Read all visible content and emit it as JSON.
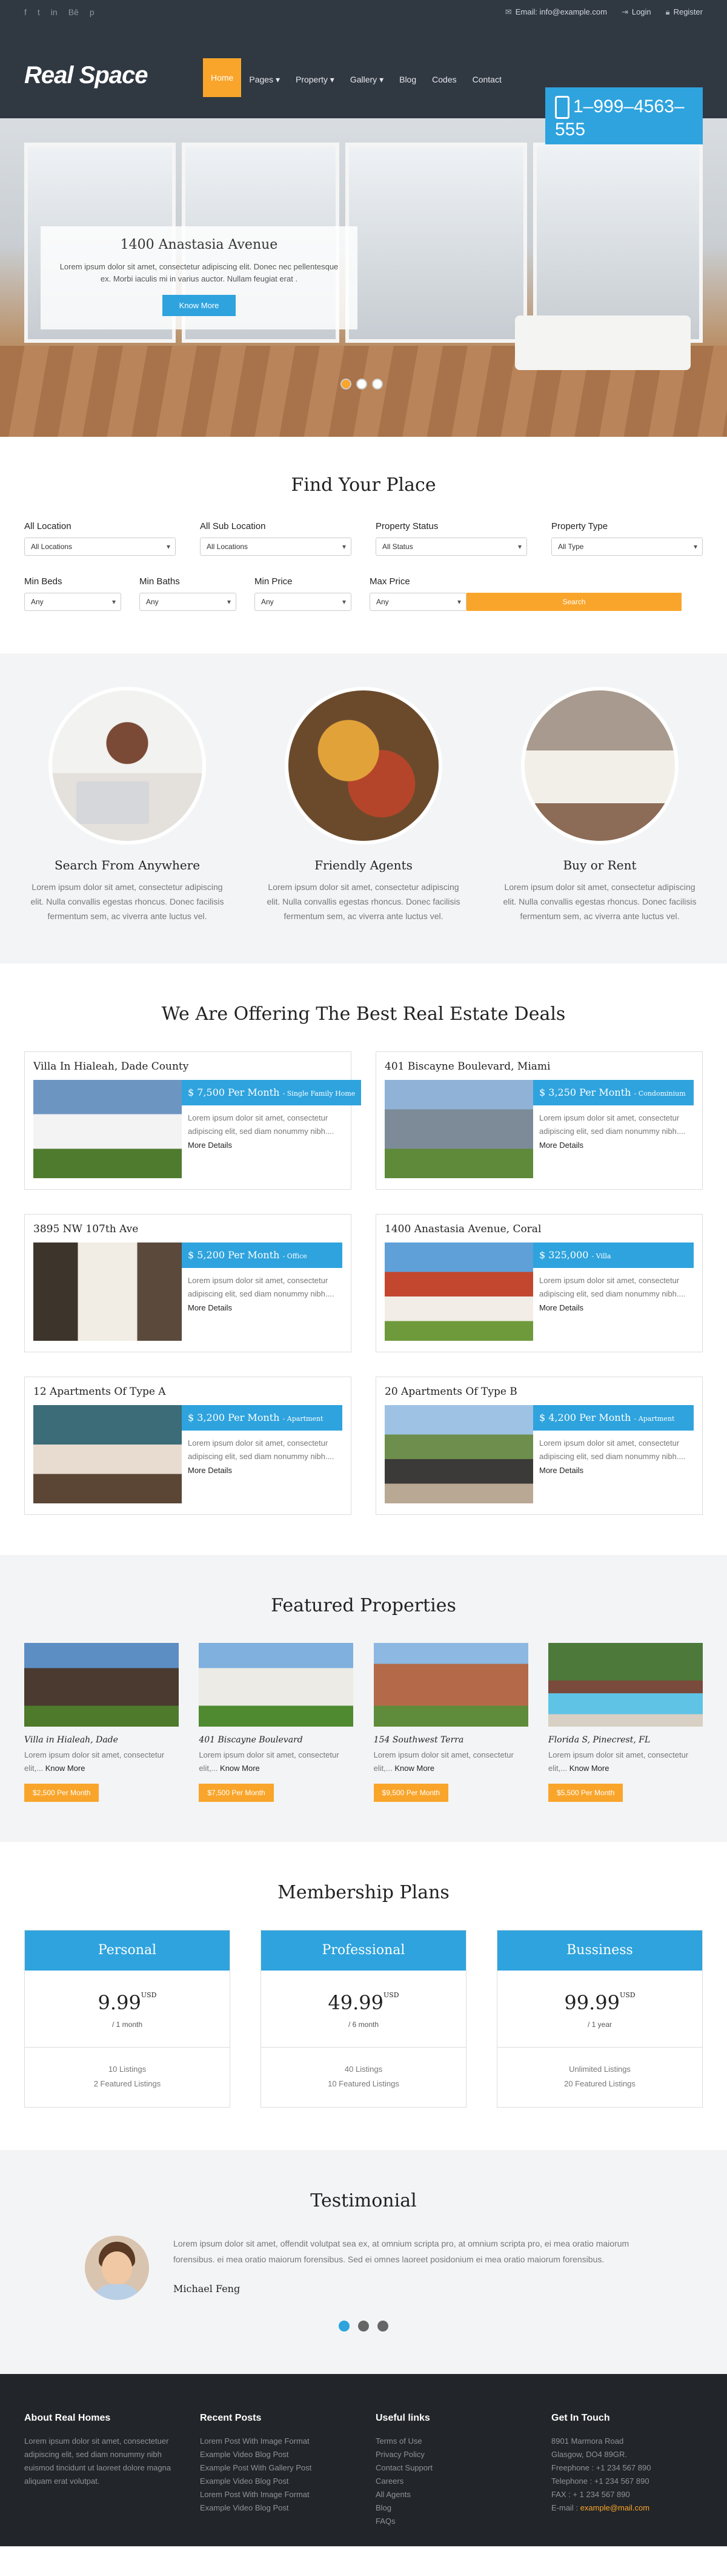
{
  "topbar": {
    "socials": [
      "f",
      "t",
      "in",
      "Bē",
      "p"
    ],
    "email": "Email: info@example.com",
    "login": "Login",
    "register": "Register"
  },
  "header": {
    "logo": "Real Space",
    "nav": [
      "Home",
      "Pages",
      "Property",
      "Gallery",
      "Blog",
      "Codes",
      "Contact"
    ],
    "phone": "1–999–4563–555"
  },
  "hero": {
    "title": "1400 Anastasia Avenue",
    "text": "Lorem ipsum dolor sit amet, consectetur adipiscing elit. Donec nec pellentesque ex. Morbi iaculis mi in varius auctor. Nullam feugiat erat .",
    "button": "Know More"
  },
  "find": {
    "title": "Find Your Place",
    "fields1": [
      {
        "label": "All Location",
        "value": "All Locations"
      },
      {
        "label": "All Sub Location",
        "value": "All Locations"
      },
      {
        "label": "Property Status",
        "value": "All Status"
      },
      {
        "label": "Property Type",
        "value": "All Type"
      }
    ],
    "fields2": [
      {
        "label": "Min Beds",
        "value": "Any"
      },
      {
        "label": "Min Baths",
        "value": "Any"
      },
      {
        "label": "Min Price",
        "value": "Any"
      },
      {
        "label": "Max Price",
        "value": "Any"
      }
    ],
    "search": "Search"
  },
  "features": [
    {
      "title": "Search From Anywhere",
      "text": "Lorem ipsum dolor sit amet, consectetur adipiscing elit. Nulla convallis egestas rhoncus. Donec facilisis fermentum sem, ac viverra ante luctus vel."
    },
    {
      "title": "Friendly Agents",
      "text": "Lorem ipsum dolor sit amet, consectetur adipiscing elit. Nulla convallis egestas rhoncus. Donec facilisis fermentum sem, ac viverra ante luctus vel."
    },
    {
      "title": "Buy or Rent",
      "text": "Lorem ipsum dolor sit amet, consectetur adipiscing elit. Nulla convallis egestas rhoncus. Donec facilisis fermentum sem, ac viverra ante luctus vel."
    }
  ],
  "deals": {
    "title": "We Are Offering The Best Real Estate Deals",
    "items": [
      {
        "title": "Villa In Hialeah, Dade County",
        "price": "$ 7,500 Per Month",
        "type": "- Single Family Home",
        "text": "Lorem ipsum dolor sit amet, consectetur adipiscing elit, sed diam nonummy nibh....",
        "more": "More Details"
      },
      {
        "title": "401 Biscayne Boulevard, Miami",
        "price": "$ 3,250 Per Month",
        "type": "- Condominium",
        "text": "Lorem ipsum dolor sit amet, consectetur adipiscing elit, sed diam nonummy nibh....",
        "more": "More Details"
      },
      {
        "title": "3895 NW 107th Ave",
        "price": "$ 5,200 Per Month",
        "type": "- Office",
        "text": "Lorem ipsum dolor sit amet, consectetur adipiscing elit, sed diam nonummy nibh....",
        "more": "More Details"
      },
      {
        "title": "1400 Anastasia Avenue, Coral",
        "price": "$ 325,000",
        "type": "- Villa",
        "text": "Lorem ipsum dolor sit amet, consectetur adipiscing elit, sed diam nonummy nibh....",
        "more": "More Details"
      },
      {
        "title": "12 Apartments Of Type A",
        "price": "$ 3,200 Per Month",
        "type": "- Apartment",
        "text": "Lorem ipsum dolor sit amet, consectetur adipiscing elit, sed diam nonummy nibh....",
        "more": "More Details"
      },
      {
        "title": "20 Apartments Of Type B",
        "price": "$ 4,200 Per Month",
        "type": "- Apartment",
        "text": "Lorem ipsum dolor sit amet, consectetur adipiscing elit, sed diam nonummy nibh....",
        "more": "More Details"
      }
    ]
  },
  "featured": {
    "title": "Featured Properties",
    "items": [
      {
        "title": "Villa in Hialeah, Dade",
        "text": "Lorem ipsum dolor sit amet, consectetur elit,...",
        "more": "Know More",
        "price": "$2,500 Per Month"
      },
      {
        "title": "401 Biscayne Boulevard",
        "text": "Lorem ipsum dolor sit amet, consectetur elit,...",
        "more": "Know More",
        "price": "$7,500 Per Month"
      },
      {
        "title": "154 Southwest Terra",
        "text": "Lorem ipsum dolor sit amet, consectetur elit,...",
        "more": "Know More",
        "price": "$9,500 Per Month"
      },
      {
        "title": "Florida S, Pinecrest, FL",
        "text": "Lorem ipsum dolor sit amet, consectetur elit,...",
        "more": "Know More",
        "price": "$5,500 Per Month"
      }
    ]
  },
  "membership": {
    "title": "Membership Plans",
    "plans": [
      {
        "name": "Personal",
        "price": "9.99",
        "currency": "USD",
        "period": "/ 1 month",
        "listings": "10 Listings",
        "featured": "2 Featured Listings"
      },
      {
        "name": "Professional",
        "price": "49.99",
        "currency": "USD",
        "period": "/ 6 month",
        "listings": "40 Listings",
        "featured": "10 Featured Listings"
      },
      {
        "name": "Bussiness",
        "price": "99.99",
        "currency": "USD",
        "period": "/ 1 year",
        "listings": "Unlimited Listings",
        "featured": "20 Featured Listings"
      }
    ]
  },
  "testimonial": {
    "title": "Testimonial",
    "text": "Lorem ipsum dolor sit amet, offendit volutpat sea ex, at omnium scripta pro, at omnium scripta pro, ei mea oratio maiorum forensibus. ei mea oratio maiorum forensibus. Sed ei omnes laoreet posidonium ei mea oratio maiorum forensibus.",
    "name": "Michael Feng"
  },
  "footer": {
    "about_title": "About Real Homes",
    "about_text": "Lorem ipsum dolor sit amet, consectetuer adipiscing elit, sed diam nonummy nibh euismod tincidunt ut laoreet dolore magna aliquam erat volutpat.",
    "posts_title": "Recent Posts",
    "posts": [
      "Lorem Post With Image Format",
      "Example Video Blog Post",
      "Example Post With Gallery Post",
      "Example Video Blog Post",
      "Lorem Post With Image Format",
      "Example Video Blog Post"
    ],
    "links_title": "Useful links",
    "links": [
      "Terms of Use",
      "Privacy Policy",
      "Contact Support",
      "Careers",
      "All Agents",
      "Blog",
      "FAQs"
    ],
    "contact_title": "Get In Touch",
    "contact": [
      "8901 Marmora Road",
      "Glasgow, DO4 89GR.",
      "Freephone : +1 234 567 890",
      "Telephone : +1 234 567 890",
      "FAX : + 1 234 567 890"
    ],
    "email_label": "E-mail :",
    "email": "example@mail.com"
  },
  "colors": {
    "accent_orange": "#f9a52b",
    "accent_blue": "#2ea3de",
    "header_bg": "#303842",
    "footer_bg": "#222529"
  }
}
